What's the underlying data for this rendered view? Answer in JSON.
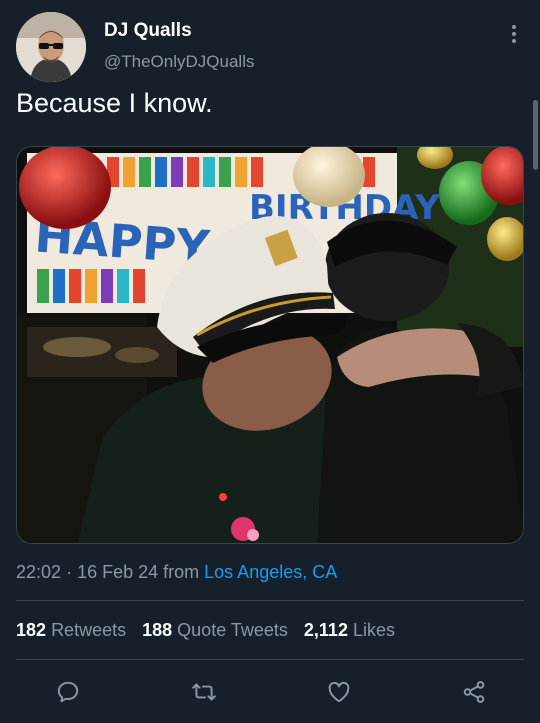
{
  "author": {
    "display_name": "DJ Qualls",
    "handle": "@TheOnlyDJQualls"
  },
  "tweet": {
    "text": "Because I know.",
    "time": "22:02",
    "date": "16 Feb 24",
    "from_label": "from",
    "location": "Los Angeles, CA",
    "photo": {
      "banner_text_left": "HAPPY",
      "banner_text_right": "BIRTHDAY"
    }
  },
  "stats": {
    "retweets": {
      "count": "182",
      "label": "Retweets"
    },
    "quote_tweets": {
      "count": "188",
      "label": "Quote Tweets"
    },
    "likes": {
      "count": "2,112",
      "label": "Likes"
    }
  },
  "icons": {
    "more": "more-vertical-icon",
    "reply": "reply-icon",
    "retweet": "retweet-icon",
    "like": "heart-icon",
    "share": "share-icon"
  },
  "colors": {
    "background": "#15202b",
    "secondary_text": "#8b98a5",
    "link": "#1d9bf0",
    "divider": "#38444d"
  }
}
